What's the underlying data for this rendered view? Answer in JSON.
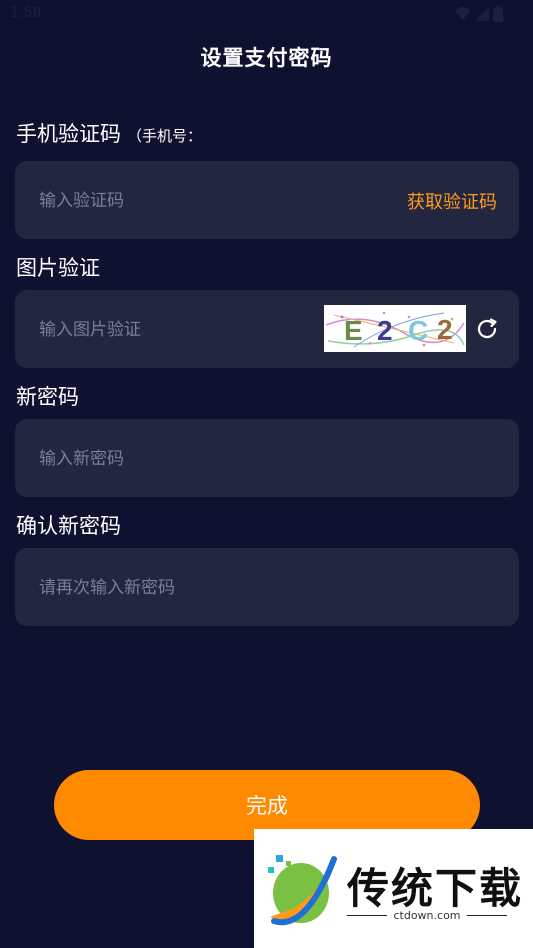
{
  "status_bar": {
    "time": "1:58"
  },
  "header": {
    "title": "设置支付密码"
  },
  "sms": {
    "label": "手机验证码",
    "sub_label": "（手机号：",
    "placeholder": "输入验证码",
    "get_code_label": "获取验证码"
  },
  "image_captcha": {
    "label": "图片验证",
    "placeholder": "输入图片验证",
    "code": "E2C2"
  },
  "new_password": {
    "label": "新密码",
    "placeholder": "输入新密码"
  },
  "confirm_password": {
    "label": "确认新密码",
    "placeholder": "请再次输入新密码"
  },
  "submit": {
    "label": "完成"
  },
  "watermark": {
    "brand": "传统下载",
    "url": "ctdown.com"
  },
  "colors": {
    "background": "#0e1230",
    "field": "#22263e",
    "accent": "#ff8a00",
    "link": "#ff9a1f"
  },
  "icons": [
    "wifi-icon",
    "signal-icon",
    "battery-icon",
    "refresh-icon",
    "logo-icon"
  ]
}
